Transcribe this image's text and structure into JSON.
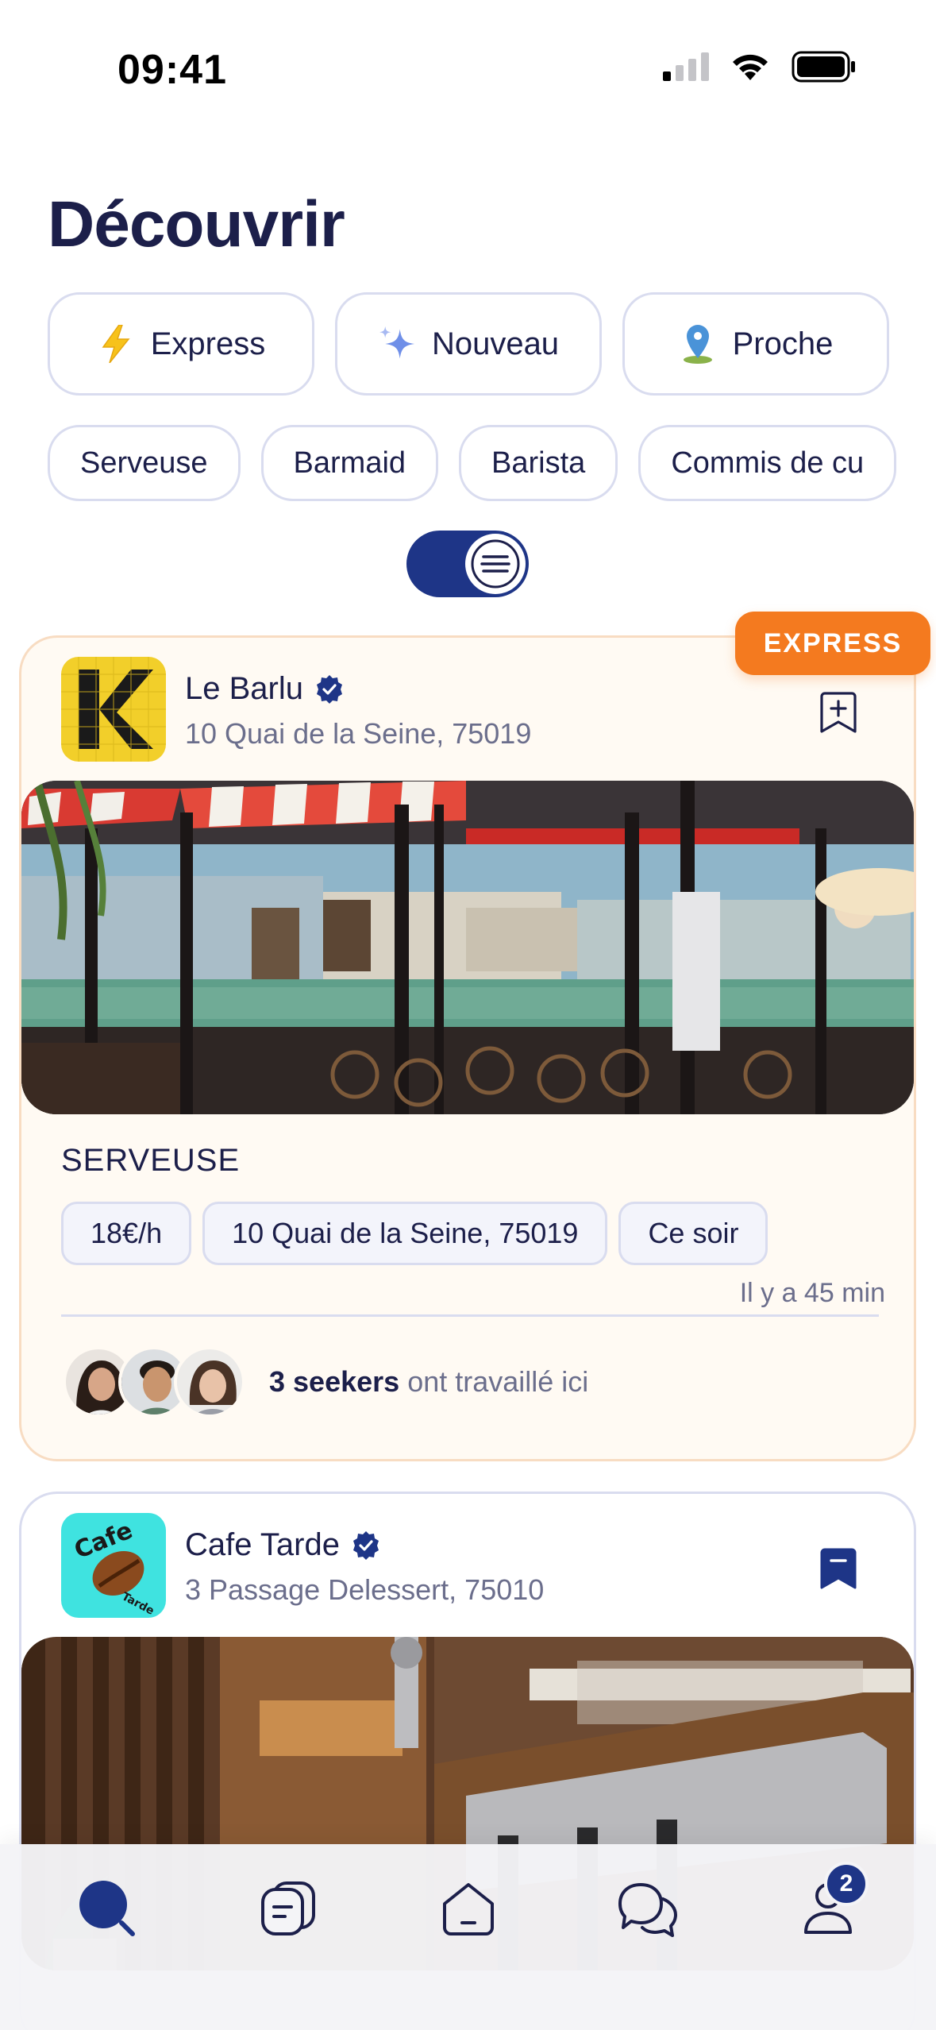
{
  "status_bar": {
    "time": "09:41"
  },
  "page": {
    "title": "Découvrir"
  },
  "categories": [
    {
      "label": "Express",
      "icon": "lightning-icon"
    },
    {
      "label": "Nouveau",
      "icon": "sparkle-icon"
    },
    {
      "label": "Proche",
      "icon": "location-pin-icon"
    }
  ],
  "roles": [
    "Serveuse",
    "Barmaid",
    "Barista",
    "Commis de cu"
  ],
  "view_toggle": {
    "state": "list",
    "on": true
  },
  "jobs": [
    {
      "badge": "EXPRESS",
      "business": "Le Barlu",
      "verified": true,
      "address": "10 Quai de la Seine, 75019",
      "bookmarked": false,
      "role": "SERVEUSE",
      "tags": [
        "18€/h",
        "10 Quai de la Seine, 75019",
        "Ce soir"
      ],
      "posted": "Il y a 45 min",
      "seekers_count": "3 seekers",
      "seekers_text": "ont travaillé ici"
    },
    {
      "business": "Cafe Tarde",
      "verified": true,
      "address": "3 Passage Delessert, 75010",
      "bookmarked": true,
      "logo_text_1": "Cafe",
      "logo_text_2": "Tarde"
    }
  ],
  "tab_bar": {
    "tabs": [
      "search-icon",
      "missions-icon",
      "home-icon",
      "chat-icon",
      "profile-icon"
    ],
    "active": "search-icon",
    "profile_badge": "2"
  },
  "colors": {
    "primary": "#1e3587",
    "express": "#f47a1f",
    "card_bg": "#fffaf3",
    "border": "#d9dcef",
    "text": "#1c1f4a",
    "muted": "#6b6e8c"
  }
}
